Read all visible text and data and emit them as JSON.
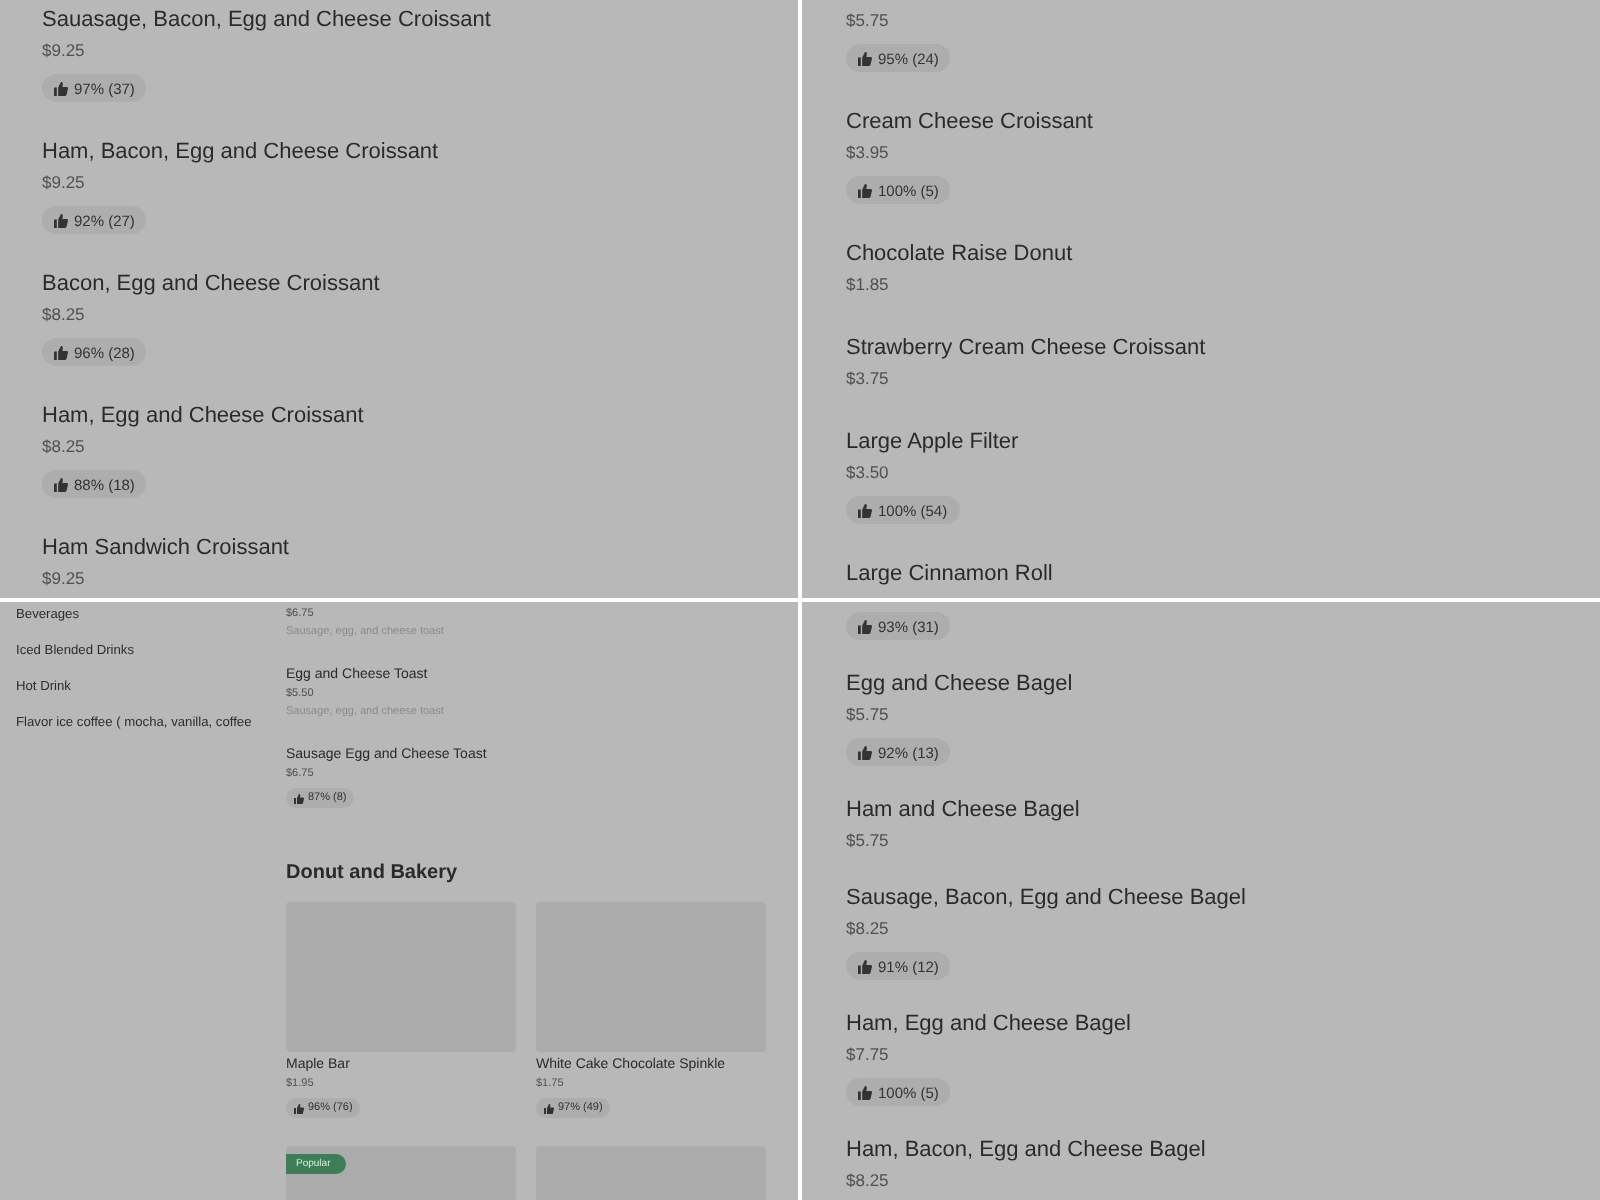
{
  "panels": [
    {
      "kind": "list",
      "items": [
        {
          "name": "Sauasage, Bacon, Egg and Cheese Croissant",
          "price": "$9.25",
          "rating": "97% (37)"
        },
        {
          "name": "Ham, Bacon, Egg and Cheese Croissant",
          "price": "$9.25",
          "rating": "92% (27)"
        },
        {
          "name": "Bacon, Egg and Cheese Croissant",
          "price": "$8.25",
          "rating": "96% (28)"
        },
        {
          "name": "Ham, Egg and Cheese Croissant",
          "price": "$8.25",
          "rating": "88% (18)"
        },
        {
          "name": "Ham Sandwich Croissant",
          "price": "$9.25"
        }
      ]
    },
    {
      "kind": "list",
      "items": [
        {
          "price": "$5.75",
          "rating": "95% (24)"
        },
        {
          "name": "Cream Cheese Croissant",
          "price": "$3.95",
          "rating": "100% (5)"
        },
        {
          "name": "Chocolate Raise Donut",
          "price": "$1.85"
        },
        {
          "name": "Strawberry Cream Cheese Croissant",
          "price": "$3.75"
        },
        {
          "name": "Large Apple Filter",
          "price": "$3.50",
          "rating": "100% (54)"
        },
        {
          "name": "Large Cinnamon Roll"
        }
      ]
    },
    {
      "kind": "store",
      "sidebar": [
        "Beverages",
        "Iced Blended Drinks",
        "Hot Drink",
        "Flavor ice coffee ( mocha, vanilla, coffee"
      ],
      "items": [
        {
          "price": "$6.75",
          "description": "Sausage, egg, and cheese toast"
        },
        {
          "name": "Egg and Cheese Toast",
          "price": "$5.50",
          "description": "Sausage, egg, and cheese toast"
        },
        {
          "name": "Sausage Egg and Cheese Toast",
          "price": "$6.75",
          "rating": "87% (8)"
        }
      ],
      "section": {
        "title": "Donut and Bakery",
        "cards": [
          {
            "kind": "product",
            "name": "Maple Bar",
            "price": "$1.95",
            "rating": "96% (76)"
          },
          {
            "kind": "product",
            "name": "White Cake Chocolate Spinkle",
            "price": "$1.75",
            "rating": "97% (49)"
          },
          {
            "kind": "product",
            "badge": "Popular"
          },
          {
            "kind": "product"
          }
        ]
      }
    },
    {
      "kind": "list",
      "items": [
        {
          "rating": "93% (31)"
        },
        {
          "name": "Egg and Cheese Bagel",
          "price": "$5.75",
          "rating": "92% (13)"
        },
        {
          "name": "Ham and Cheese Bagel",
          "price": "$5.75"
        },
        {
          "name": "Sausage, Bacon, Egg and Cheese Bagel",
          "price": "$8.25",
          "rating": "91% (12)"
        },
        {
          "name": "Ham, Egg and Cheese Bagel",
          "price": "$7.75",
          "rating": "100% (5)"
        },
        {
          "name": "Ham, Bacon, Egg and Cheese Bagel",
          "price": "$8.25"
        }
      ]
    }
  ]
}
